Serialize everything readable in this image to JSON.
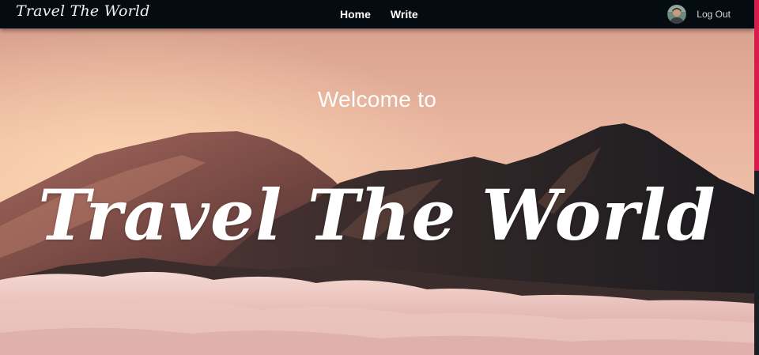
{
  "brand": {
    "name": "Travel The World"
  },
  "nav": {
    "links": [
      {
        "label": "Home"
      },
      {
        "label": "Write"
      }
    ]
  },
  "user": {
    "logout_label": "Log Out"
  },
  "hero": {
    "welcome": "Welcome to",
    "title": "Travel The World"
  },
  "colors": {
    "navbar": "#040c12",
    "scroll_thumb": "#d81b4c",
    "sky_top": "#e9b49e",
    "mountain_dark": "#2c2628"
  }
}
